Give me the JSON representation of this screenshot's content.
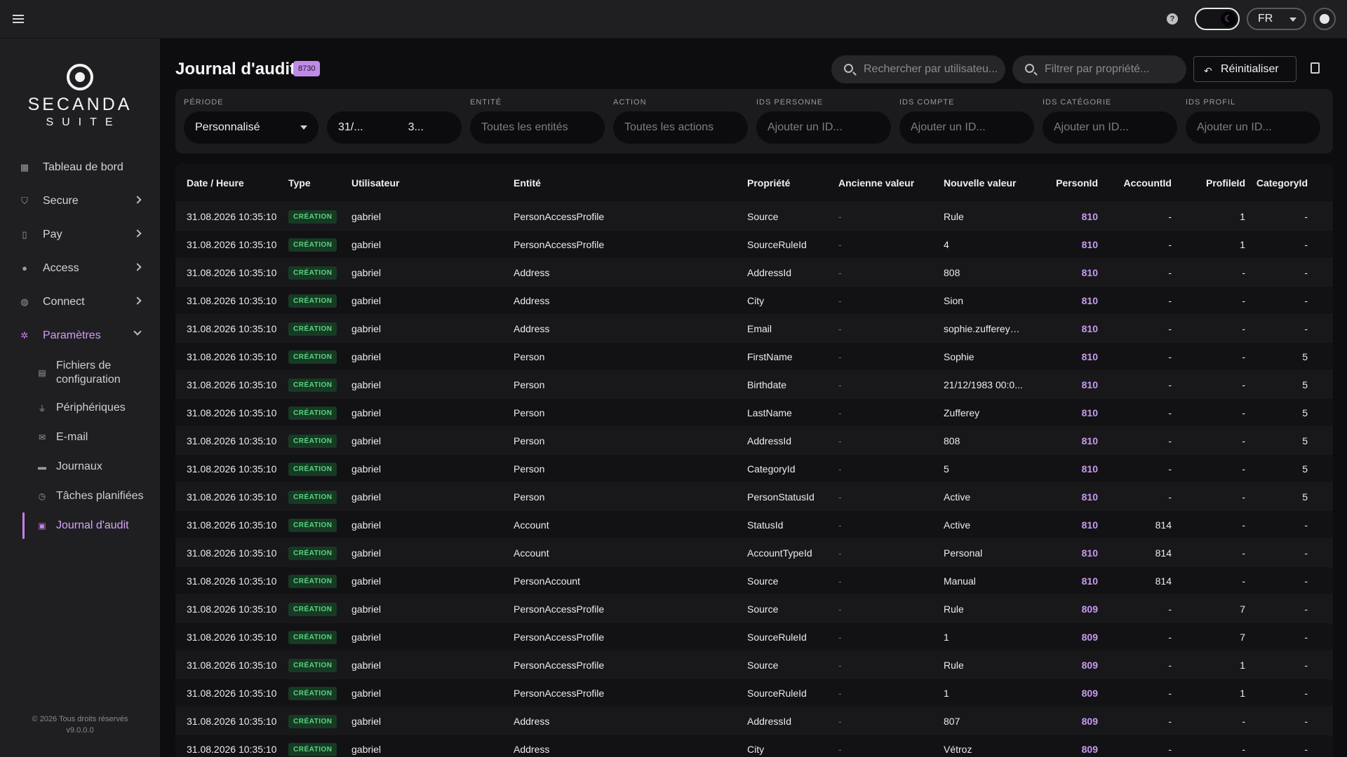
{
  "topbar": {
    "help_icon": "?",
    "theme_icon": "moon-icon",
    "lang": "FR"
  },
  "sidebar": {
    "logo_name": "SECANDA",
    "logo_sub": "SUITE",
    "items": [
      {
        "label": "Tableau de bord",
        "icon": "grid-icon"
      },
      {
        "label": "Secure",
        "icon": "shield-icon"
      },
      {
        "label": "Pay",
        "icon": "phone-icon"
      },
      {
        "label": "Access",
        "icon": "lock-icon"
      },
      {
        "label": "Connect",
        "icon": "globe-icon"
      },
      {
        "label": "Paramètres",
        "icon": "gear-icon"
      }
    ],
    "subitems": [
      {
        "label": "Fichiers de configuration",
        "icon": "file-icon"
      },
      {
        "label": "Périphériques",
        "icon": "plug-icon"
      },
      {
        "label": "E-mail",
        "icon": "mail-icon"
      },
      {
        "label": "Journaux",
        "icon": "scroll-icon"
      },
      {
        "label": "Tâches planifiées",
        "icon": "clock-icon"
      },
      {
        "label": "Journal d'audit",
        "icon": "clipboard-icon"
      }
    ],
    "footer_copyright": "© 2026 Tous droits réservés",
    "footer_version": "v9.0.0.0"
  },
  "header": {
    "title": "Journal d'audit",
    "count": "8730",
    "search_user_placeholder": "Rechercher par utilisateu...",
    "filter_prop_placeholder": "Filtrer par propriété...",
    "reset_label": "Réinitialiser"
  },
  "filters": {
    "periode_label": "PÉRIODE",
    "periode_value": "Personnalisé",
    "date_from": "31/...",
    "date_to": "3...",
    "entite_label": "ENTITÉ",
    "entite_placeholder": "Toutes les entités",
    "action_label": "ACTION",
    "action_placeholder": "Toutes les actions",
    "ids_personne_label": "IDS PERSONNE",
    "ids_compte_label": "IDS COMPTE",
    "ids_categorie_label": "IDS CATÉGORIE",
    "ids_profil_label": "IDS PROFIL",
    "id_placeholder": "Ajouter un ID..."
  },
  "table": {
    "columns": [
      "Date / Heure",
      "Type",
      "Utilisateur",
      "Entité",
      "Propriété",
      "Ancienne valeur",
      "Nouvelle valeur",
      "PersonId",
      "AccountId",
      "ProfileId",
      "CategoryId"
    ],
    "rows": [
      [
        "31.08.2026 10:35:10",
        "CRÉATION",
        "gabriel",
        "PersonAccessProfile",
        "Source",
        "-",
        "Rule",
        "810",
        "-",
        "1",
        "-"
      ],
      [
        "31.08.2026 10:35:10",
        "CRÉATION",
        "gabriel",
        "PersonAccessProfile",
        "SourceRuleId",
        "-",
        "4",
        "810",
        "-",
        "1",
        "-"
      ],
      [
        "31.08.2026 10:35:10",
        "CRÉATION",
        "gabriel",
        "Address",
        "AddressId",
        "-",
        "808",
        "810",
        "-",
        "-",
        "-"
      ],
      [
        "31.08.2026 10:35:10",
        "CRÉATION",
        "gabriel",
        "Address",
        "City",
        "-",
        "Sion",
        "810",
        "-",
        "-",
        "-"
      ],
      [
        "31.08.2026 10:35:10",
        "CRÉATION",
        "gabriel",
        "Address",
        "Email",
        "-",
        "sophie.zufferey@...",
        "810",
        "-",
        "-",
        "-"
      ],
      [
        "31.08.2026 10:35:10",
        "CRÉATION",
        "gabriel",
        "Person",
        "FirstName",
        "-",
        "Sophie",
        "810",
        "-",
        "-",
        "5"
      ],
      [
        "31.08.2026 10:35:10",
        "CRÉATION",
        "gabriel",
        "Person",
        "Birthdate",
        "-",
        "21/12/1983 00:0...",
        "810",
        "-",
        "-",
        "5"
      ],
      [
        "31.08.2026 10:35:10",
        "CRÉATION",
        "gabriel",
        "Person",
        "LastName",
        "-",
        "Zufferey",
        "810",
        "-",
        "-",
        "5"
      ],
      [
        "31.08.2026 10:35:10",
        "CRÉATION",
        "gabriel",
        "Person",
        "AddressId",
        "-",
        "808",
        "810",
        "-",
        "-",
        "5"
      ],
      [
        "31.08.2026 10:35:10",
        "CRÉATION",
        "gabriel",
        "Person",
        "CategoryId",
        "-",
        "5",
        "810",
        "-",
        "-",
        "5"
      ],
      [
        "31.08.2026 10:35:10",
        "CRÉATION",
        "gabriel",
        "Person",
        "PersonStatusId",
        "-",
        "Active",
        "810",
        "-",
        "-",
        "5"
      ],
      [
        "31.08.2026 10:35:10",
        "CRÉATION",
        "gabriel",
        "Account",
        "StatusId",
        "-",
        "Active",
        "810",
        "814",
        "-",
        "-"
      ],
      [
        "31.08.2026 10:35:10",
        "CRÉATION",
        "gabriel",
        "Account",
        "AccountTypeId",
        "-",
        "Personal",
        "810",
        "814",
        "-",
        "-"
      ],
      [
        "31.08.2026 10:35:10",
        "CRÉATION",
        "gabriel",
        "PersonAccount",
        "Source",
        "-",
        "Manual",
        "810",
        "814",
        "-",
        "-"
      ],
      [
        "31.08.2026 10:35:10",
        "CRÉATION",
        "gabriel",
        "PersonAccessProfile",
        "Source",
        "-",
        "Rule",
        "809",
        "-",
        "7",
        "-"
      ],
      [
        "31.08.2026 10:35:10",
        "CRÉATION",
        "gabriel",
        "PersonAccessProfile",
        "SourceRuleId",
        "-",
        "1",
        "809",
        "-",
        "7",
        "-"
      ],
      [
        "31.08.2026 10:35:10",
        "CRÉATION",
        "gabriel",
        "PersonAccessProfile",
        "Source",
        "-",
        "Rule",
        "809",
        "-",
        "1",
        "-"
      ],
      [
        "31.08.2026 10:35:10",
        "CRÉATION",
        "gabriel",
        "PersonAccessProfile",
        "SourceRuleId",
        "-",
        "1",
        "809",
        "-",
        "1",
        "-"
      ],
      [
        "31.08.2026 10:35:10",
        "CRÉATION",
        "gabriel",
        "Address",
        "AddressId",
        "-",
        "807",
        "809",
        "-",
        "-",
        "-"
      ],
      [
        "31.08.2026 10:35:10",
        "CRÉATION",
        "gabriel",
        "Address",
        "City",
        "-",
        "Vétroz",
        "809",
        "-",
        "-",
        "-"
      ]
    ]
  },
  "colors": {
    "accent": "#c77dee",
    "badge_green_bg": "#173a24",
    "badge_green_text": "#59d67f"
  }
}
